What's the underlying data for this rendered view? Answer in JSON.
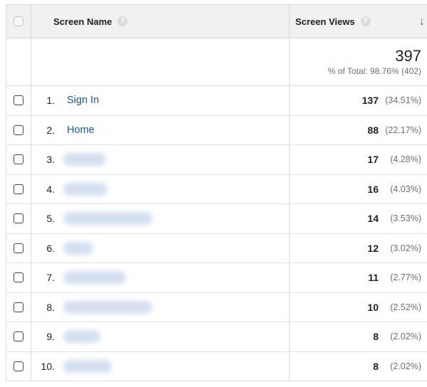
{
  "header": {
    "screen_name_label": "Screen Name",
    "screen_views_label": "Screen Views",
    "help_glyph": "?",
    "sort_glyph": "↓"
  },
  "totals": {
    "views": "397",
    "percent_label": "% of Total: 98.76% (402)"
  },
  "rows": [
    {
      "rank": "1.",
      "name": "Sign In",
      "views": "137",
      "pct": "(34.51%)"
    },
    {
      "rank": "2.",
      "name": "Home",
      "views": "88",
      "pct": "(22.17%)"
    },
    {
      "rank": "3.",
      "name": "",
      "views": "17",
      "pct": "(4.28%)"
    },
    {
      "rank": "4.",
      "name": "",
      "views": "16",
      "pct": "(4.03%)"
    },
    {
      "rank": "5.",
      "name": "",
      "views": "14",
      "pct": "(3.53%)"
    },
    {
      "rank": "6.",
      "name": "",
      "views": "12",
      "pct": "(3.02%)"
    },
    {
      "rank": "7.",
      "name": "",
      "views": "11",
      "pct": "(2.77%)"
    },
    {
      "rank": "8.",
      "name": "",
      "views": "10",
      "pct": "(2.52%)"
    },
    {
      "rank": "9.",
      "name": "",
      "views": "8",
      "pct": "(2.02%)"
    },
    {
      "rank": "10.",
      "name": "",
      "views": "8",
      "pct": "(2.02%)"
    }
  ],
  "colors": {
    "link": "#1a5a9a",
    "header_bg": "#f1f1f1",
    "border": "#d9d9d9"
  }
}
